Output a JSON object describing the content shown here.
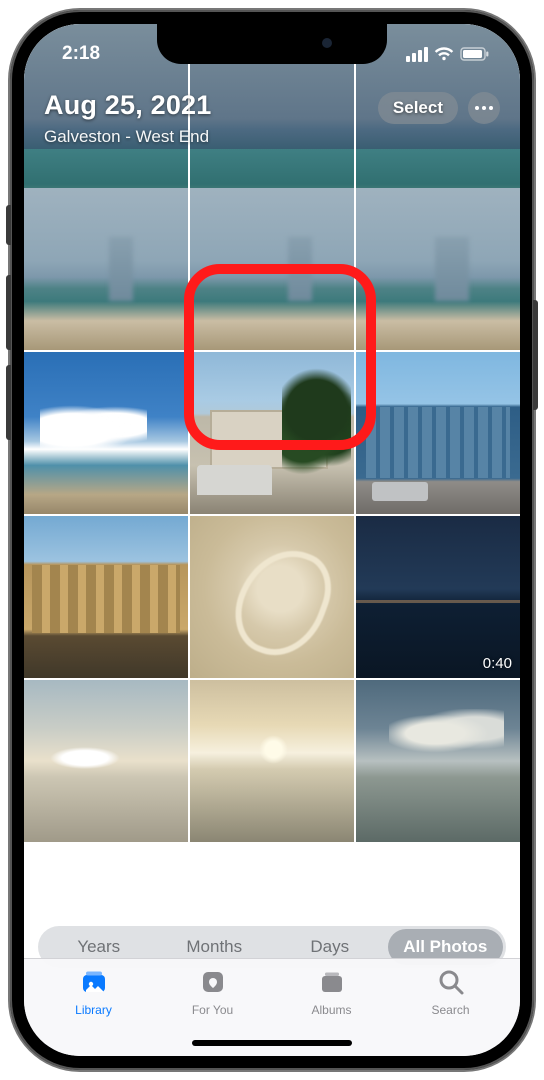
{
  "status": {
    "time": "2:18"
  },
  "header": {
    "title": "Aug 25, 2021",
    "subtitle": "Galveston - West End",
    "select_label": "Select"
  },
  "grid": {
    "video_badge": "0:40"
  },
  "segmented": {
    "items": [
      "Years",
      "Months",
      "Days",
      "All Photos"
    ],
    "active_index": 3
  },
  "tabs": {
    "items": [
      "Library",
      "For You",
      "Albums",
      "Search"
    ],
    "active_index": 0
  },
  "highlight": {
    "row": 1,
    "col": 1
  }
}
